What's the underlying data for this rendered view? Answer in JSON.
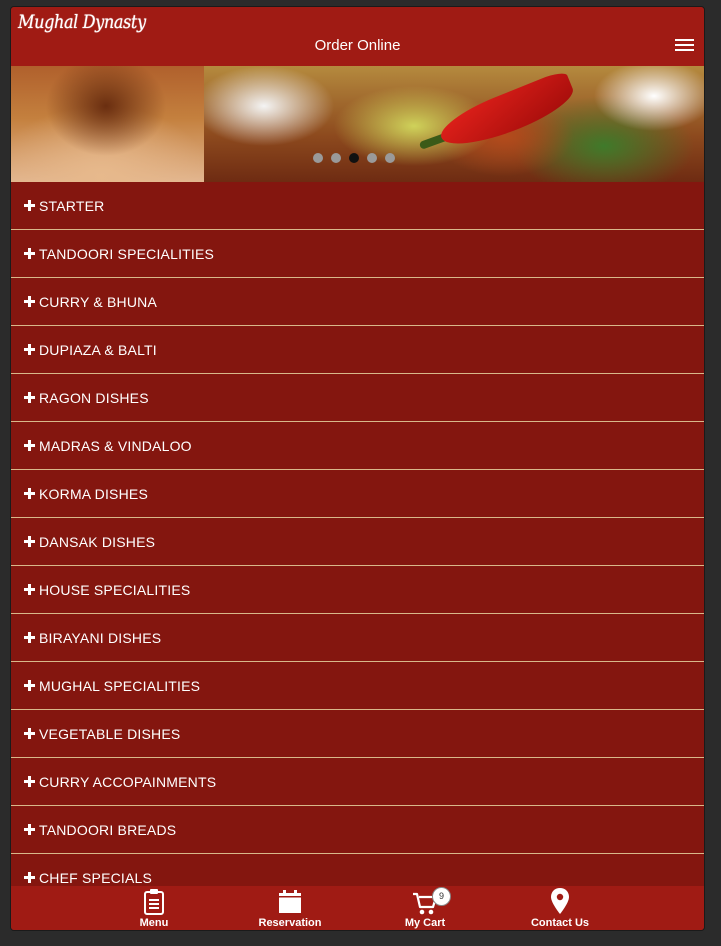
{
  "header": {
    "logo_text": "Mughal Dynasty",
    "title": "Order Online"
  },
  "carousel": {
    "slide_count": 5,
    "active_index": 2
  },
  "menu": {
    "categories": [
      "STARTER",
      "TANDOORI SPECIALITIES",
      "CURRY & BHUNA",
      "DUPIAZA & BALTI",
      "RAGON DISHES",
      "MADRAS & VINDALOO",
      "KORMA DISHES",
      "DANSAK DISHES",
      "HOUSE SPECIALITIES",
      "BIRAYANI DISHES",
      "MUGHAL SPECIALITIES",
      "VEGETABLE DISHES",
      "CURRY ACCOPAINMENTS",
      "TANDOORI BREADS",
      "CHEF SPECIALS"
    ],
    "expand_icon": "plus-icon"
  },
  "bottom_nav": {
    "menu_label": "Menu",
    "reservation_label": "Reservation",
    "cart_label": "My Cart",
    "cart_count": "9",
    "contact_label": "Contact Us"
  },
  "colors": {
    "header_bg": "#a01b14",
    "list_bg": "#84160f",
    "divider": "#d9b88a",
    "page_bg": "#2b2b2b"
  }
}
